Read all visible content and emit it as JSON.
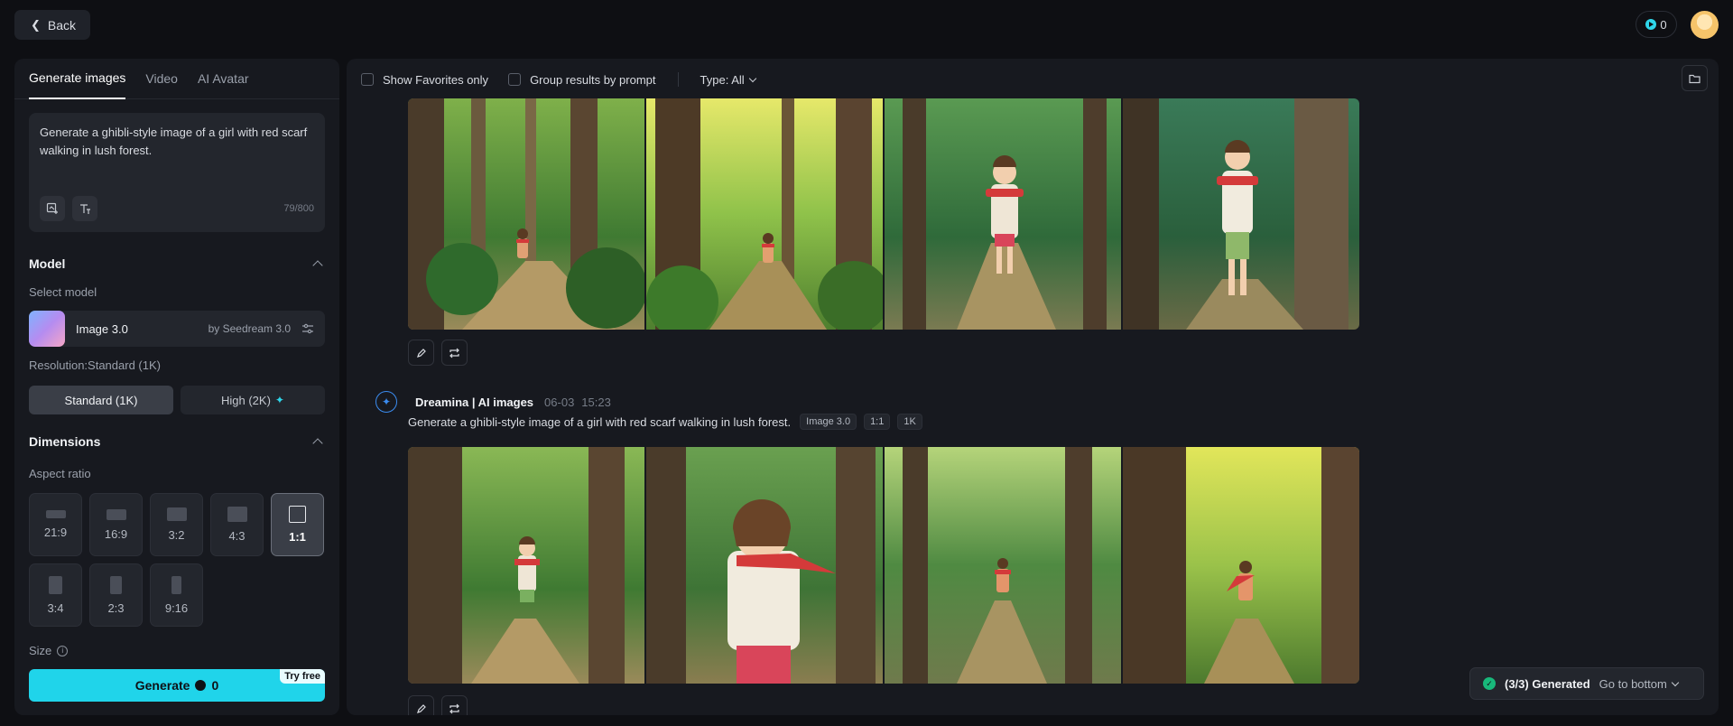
{
  "topbar": {
    "back_label": "Back",
    "credits": "0"
  },
  "left": {
    "tabs": [
      "Generate images",
      "Video",
      "AI Avatar"
    ],
    "prompt": "Generate a ghibli-style image of a girl with red scarf walking in lush forest.",
    "char_count": "79/800",
    "model_section": "Model",
    "select_model_label": "Select model",
    "model_name": "Image 3.0",
    "model_by": "by Seedream 3.0",
    "resolution_label": "Resolution:Standard (1K)",
    "resolution_options": [
      "Standard (1K)",
      "High (2K)"
    ],
    "dimensions_section": "Dimensions",
    "aspect_label": "Aspect ratio",
    "ratios": [
      "21:9",
      "16:9",
      "3:2",
      "4:3",
      "1:1",
      "3:4",
      "2:3",
      "9:16"
    ],
    "selected_ratio": "1:1",
    "size_label": "Size",
    "generate_label": "Generate",
    "generate_cost": "0",
    "try_free": "Try free"
  },
  "main": {
    "filters": {
      "favorites": "Show Favorites only",
      "group": "Group results by prompt",
      "type": "Type: All"
    },
    "group": {
      "brand": "Dreamina | AI images",
      "date": "06-03",
      "time": "15:23",
      "prompt": "Generate a ghibli-style image of a girl with red scarf walking in lush forest.",
      "tags": [
        "Image 3.0",
        "1:1",
        "1K"
      ]
    },
    "toast": {
      "status": "(3/3) Generated",
      "link": "Go to bottom"
    }
  },
  "colors": {
    "accent": "#20d4ea",
    "brand_blue": "#3b8cf0",
    "success": "#18b87b"
  }
}
